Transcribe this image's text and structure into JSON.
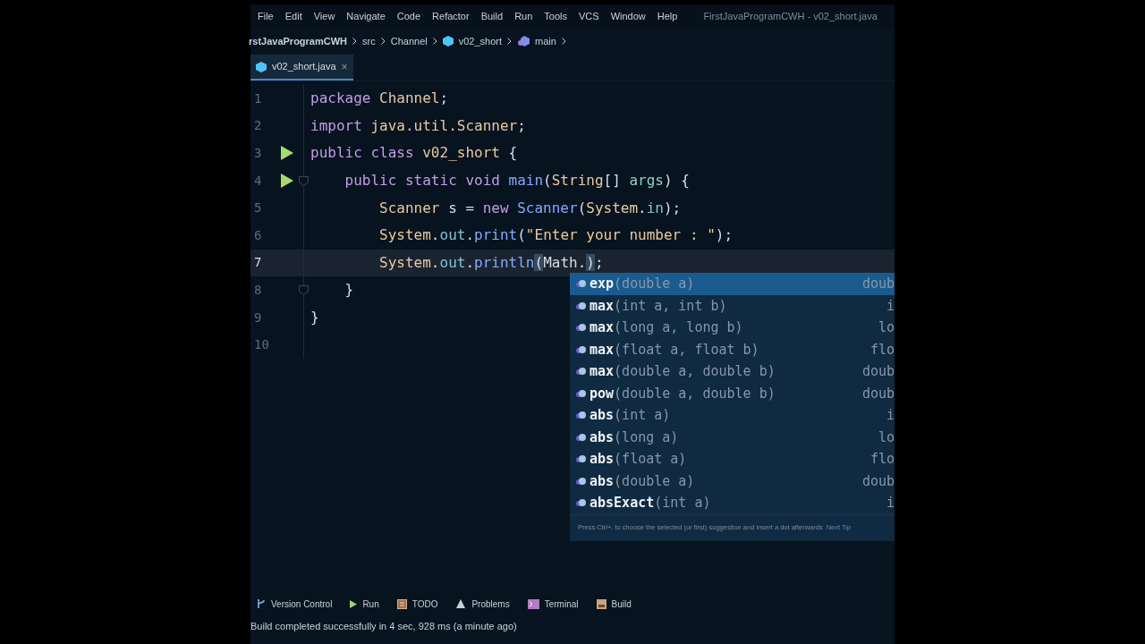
{
  "menu": [
    "File",
    "Edit",
    "View",
    "Navigate",
    "Code",
    "Refactor",
    "Build",
    "Run",
    "Tools",
    "VCS",
    "Window",
    "Help"
  ],
  "window": {
    "title": "FirstJavaProgramCWH - v02_short.java"
  },
  "breadcrumbs": [
    {
      "label": "rstJavaProgramCWH",
      "kind": "project"
    },
    {
      "label": "src",
      "kind": "folder"
    },
    {
      "label": "Channel",
      "kind": "folder"
    },
    {
      "label": "v02_short",
      "kind": "class"
    },
    {
      "label": "main",
      "kind": "method"
    }
  ],
  "tabs": [
    {
      "label": "v02_short.java",
      "close": "×",
      "selected": true
    }
  ],
  "editor": {
    "lines": [
      {
        "number": "1",
        "run": false,
        "current": false,
        "fold": false,
        "tokens": [
          {
            "text": "package ",
            "kind": "kw"
          },
          {
            "text": "Channel",
            "kind": "type"
          },
          {
            "text": ";",
            "kind": "plain"
          }
        ]
      },
      {
        "number": "2",
        "run": false,
        "current": false,
        "fold": false,
        "tokens": [
          {
            "text": "import ",
            "kind": "kw"
          },
          {
            "text": "java.util.Scanner",
            "kind": "type"
          },
          {
            "text": ";",
            "kind": "plain"
          }
        ]
      },
      {
        "number": "3",
        "run": true,
        "current": false,
        "fold": false,
        "tokens": [
          {
            "text": "public class ",
            "kind": "kw"
          },
          {
            "text": "v02_short",
            "kind": "type"
          },
          {
            "text": " {",
            "kind": "plain"
          }
        ]
      },
      {
        "number": "4",
        "run": true,
        "current": false,
        "fold": true,
        "tokens": [
          {
            "text": "    public static void ",
            "kind": "kw"
          },
          {
            "text": "main",
            "kind": "method"
          },
          {
            "text": "(",
            "kind": "plain"
          },
          {
            "text": "String",
            "kind": "type"
          },
          {
            "text": "[] ",
            "kind": "plain"
          },
          {
            "text": "args",
            "kind": "param"
          },
          {
            "text": ") {",
            "kind": "plain"
          }
        ]
      },
      {
        "number": "5",
        "run": false,
        "current": false,
        "fold": false,
        "tokens": [
          {
            "text": "        Scanner",
            "kind": "type"
          },
          {
            "text": " s = ",
            "kind": "plain"
          },
          {
            "text": "new ",
            "kind": "kw"
          },
          {
            "text": "Scanner",
            "kind": "method"
          },
          {
            "text": "(",
            "kind": "plain"
          },
          {
            "text": "System",
            "kind": "type"
          },
          {
            "text": ".",
            "kind": "plain"
          },
          {
            "text": "in",
            "kind": "field"
          },
          {
            "text": ");",
            "kind": "plain"
          }
        ]
      },
      {
        "number": "6",
        "run": false,
        "current": false,
        "fold": false,
        "tokens": [
          {
            "text": "        System",
            "kind": "type"
          },
          {
            "text": ".",
            "kind": "plain"
          },
          {
            "text": "out",
            "kind": "field"
          },
          {
            "text": ".",
            "kind": "plain"
          },
          {
            "text": "print",
            "kind": "method"
          },
          {
            "text": "(",
            "kind": "plain"
          },
          {
            "text": "\"Enter your number : \"",
            "kind": "string"
          },
          {
            "text": ");",
            "kind": "plain"
          }
        ]
      },
      {
        "number": "7",
        "run": false,
        "current": true,
        "fold": false,
        "tokens": [
          {
            "text": "        System",
            "kind": "type"
          },
          {
            "text": ".",
            "kind": "plain"
          },
          {
            "text": "out",
            "kind": "field"
          },
          {
            "text": ".",
            "kind": "plain"
          },
          {
            "text": "println",
            "kind": "method"
          },
          {
            "text": "(",
            "kind": "match"
          },
          {
            "text": "Math.",
            "kind": "plain"
          },
          {
            "text": ")",
            "kind": "match"
          },
          {
            "text": ";",
            "kind": "plain"
          }
        ]
      },
      {
        "number": "8",
        "run": false,
        "current": false,
        "fold": true,
        "tokens": [
          {
            "text": "    }",
            "kind": "plain"
          }
        ]
      },
      {
        "number": "9",
        "run": false,
        "current": false,
        "fold": false,
        "tokens": [
          {
            "text": "}",
            "kind": "plain"
          }
        ]
      },
      {
        "number": "10",
        "run": false,
        "current": false,
        "fold": false
      }
    ]
  },
  "completion": {
    "items": [
      {
        "name": "exp",
        "params": "(double a)",
        "returns": "doub",
        "selected": true
      },
      {
        "name": "max",
        "params": "(int a, int b)",
        "returns": "i",
        "selected": false
      },
      {
        "name": "max",
        "params": "(long a, long b)",
        "returns": "lo",
        "selected": false
      },
      {
        "name": "max",
        "params": "(float a, float b)",
        "returns": "flo",
        "selected": false
      },
      {
        "name": "max",
        "params": "(double a, double b)",
        "returns": "doub",
        "selected": false
      },
      {
        "name": "pow",
        "params": "(double a, double b)",
        "returns": "doub",
        "selected": false
      },
      {
        "name": "abs",
        "params": "(int a)",
        "returns": "i",
        "selected": false
      },
      {
        "name": "abs",
        "params": "(long a)",
        "returns": "lo",
        "selected": false
      },
      {
        "name": "abs",
        "params": "(float a)",
        "returns": "flo",
        "selected": false
      },
      {
        "name": "abs",
        "params": "(double a)",
        "returns": "doub",
        "selected": false
      },
      {
        "name": "absExact",
        "params": "(int a)",
        "returns": "i",
        "selected": false
      }
    ],
    "tip": "Press Ctrl+. to choose the selected (or first) suggestion and insert a dot afterwards",
    "tip_link": "Next Tip"
  },
  "tool_tabs": [
    {
      "label": "Version Control",
      "kind": "vcs"
    },
    {
      "label": "Run",
      "kind": "run"
    },
    {
      "label": "TODO",
      "kind": "todo"
    },
    {
      "label": "Problems",
      "kind": "problems"
    },
    {
      "label": "Terminal",
      "kind": "terminal"
    },
    {
      "label": "Build",
      "kind": "build"
    }
  ],
  "status_bar": "Build completed successfully in 4 sec, 928 ms (a minute ago)"
}
